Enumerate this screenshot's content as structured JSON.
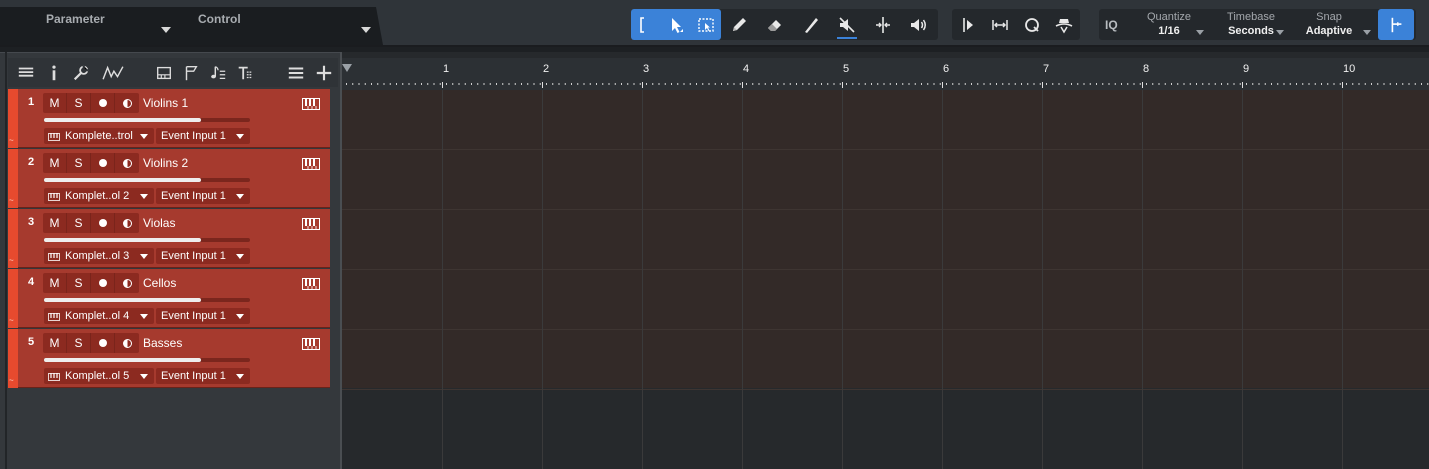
{
  "toolbar": {
    "parameter_label": "Parameter",
    "control_label": "Control",
    "tools": [
      {
        "icon": "range-bracket-icon"
      },
      {
        "icon": "arrow-tool-icon"
      },
      {
        "icon": "range-select-icon"
      },
      {
        "icon": "pencil-tool-icon"
      },
      {
        "icon": "eraser-tool-icon"
      },
      {
        "icon": "paint-tool-icon"
      },
      {
        "icon": "mute-tool-icon"
      },
      {
        "icon": "split-tool-icon"
      },
      {
        "icon": "listen-tool-icon"
      }
    ],
    "edit_tools": [
      {
        "icon": "scroll-follow-icon"
      },
      {
        "icon": "auto-scroll-icon"
      },
      {
        "icon": "quantize-q-icon"
      },
      {
        "icon": "metronome-icon"
      }
    ],
    "iq_label": "IQ",
    "quantize": {
      "label": "Quantize",
      "value": "1/16"
    },
    "timebase": {
      "label": "Timebase",
      "value": "Seconds"
    },
    "snap": {
      "label": "Snap",
      "value": "Adaptive"
    }
  },
  "track_tools": [
    {
      "icon": "track-list-icon"
    },
    {
      "icon": "inspector-info-icon"
    },
    {
      "icon": "wrench-icon"
    },
    {
      "icon": "automation-curve-icon"
    },
    {
      "icon": "pattern-grid-icon"
    },
    {
      "icon": "marker-flag-icon"
    },
    {
      "icon": "chord-note-icon"
    },
    {
      "icon": "tempo-track-icon"
    },
    {
      "icon": "layers-icon"
    },
    {
      "icon": "add-track-icon"
    }
  ],
  "tracks": [
    {
      "number": "1",
      "name": "Violins 1",
      "instrument": "Komplete..trol",
      "input": "Event Input 1",
      "volume": 0.76
    },
    {
      "number": "2",
      "name": "Violins 2",
      "instrument": "Komplet..ol 2",
      "input": "Event Input 1",
      "volume": 0.76
    },
    {
      "number": "3",
      "name": "Violas",
      "instrument": "Komplet..ol 3",
      "input": "Event Input 1",
      "volume": 0.76
    },
    {
      "number": "4",
      "name": "Cellos",
      "instrument": "Komplet..ol 4",
      "input": "Event Input 1",
      "volume": 0.76
    },
    {
      "number": "5",
      "name": "Basses",
      "instrument": "Komplet..ol 5",
      "input": "Event Input 1",
      "volume": 0.76
    }
  ],
  "track_buttons": {
    "mute": "M",
    "solo": "S"
  },
  "ruler": {
    "bars": [
      "1",
      "2",
      "3",
      "4",
      "5",
      "6",
      "7",
      "8",
      "9",
      "10"
    ]
  },
  "colors": {
    "accent_blue": "#3b82d8",
    "track_red": "#a63a2e",
    "track_strip": "#e74a2e"
  }
}
